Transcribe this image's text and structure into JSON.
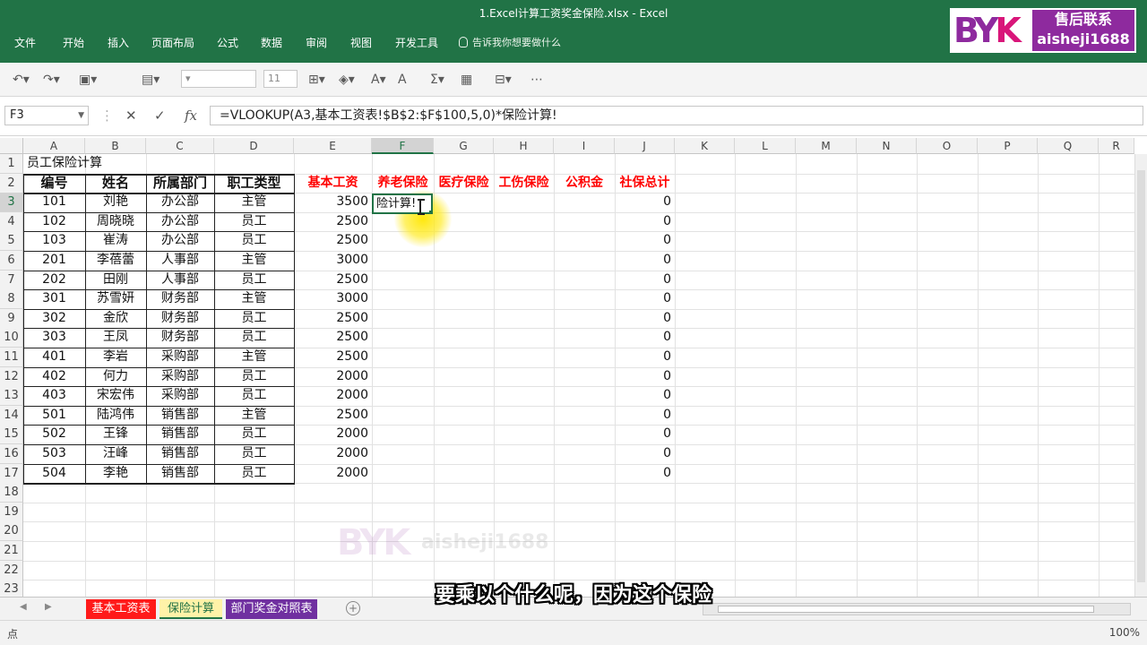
{
  "window": {
    "title": "1.Excel计算工资奖金保险.xlsx - Excel"
  },
  "menu": [
    "文件",
    "开始",
    "插入",
    "页面布局",
    "公式",
    "数据",
    "审阅",
    "视图",
    "开发工具"
  ],
  "tell_me": "告诉我你想要做什么",
  "logo": {
    "line1": "售后联系",
    "line2": "aisheji1688"
  },
  "toolbar": {
    "font_size": "11"
  },
  "formula_bar": {
    "name_box": "F3",
    "formula": "=VLOOKUP(A3,基本工资表!$B$2:$F$100,5,0)*保险计算!"
  },
  "columns": [
    "A",
    "B",
    "C",
    "D",
    "E",
    "F",
    "G",
    "H",
    "I",
    "J",
    "K",
    "L",
    "M",
    "N",
    "O",
    "P",
    "Q",
    "R"
  ],
  "rows": [
    "1",
    "2",
    "3",
    "4",
    "5",
    "6",
    "7",
    "8",
    "9",
    "10",
    "11",
    "12",
    "13",
    "14",
    "15",
    "16",
    "17",
    "18",
    "19",
    "20",
    "21",
    "22",
    "23"
  ],
  "sheet": {
    "title": "员工保险计算",
    "headers_left": [
      "编号",
      "姓名",
      "所属部门",
      "职工类型"
    ],
    "headers_right": [
      "基本工资",
      "养老保险",
      "医疗保险",
      "工伤保险",
      "公积金",
      "社保总计"
    ],
    "active_cell_text": "险计算!",
    "rows": [
      {
        "id": "101",
        "name": "刘艳",
        "dept": "办公部",
        "type": "主管",
        "salary": "3500",
        "total": "0"
      },
      {
        "id": "102",
        "name": "周晓晓",
        "dept": "办公部",
        "type": "员工",
        "salary": "2500",
        "total": "0"
      },
      {
        "id": "103",
        "name": "崔涛",
        "dept": "办公部",
        "type": "员工",
        "salary": "2500",
        "total": "0"
      },
      {
        "id": "201",
        "name": "李蓓蕾",
        "dept": "人事部",
        "type": "主管",
        "salary": "3000",
        "total": "0"
      },
      {
        "id": "202",
        "name": "田刚",
        "dept": "人事部",
        "type": "员工",
        "salary": "2500",
        "total": "0"
      },
      {
        "id": "301",
        "name": "苏雪妍",
        "dept": "财务部",
        "type": "主管",
        "salary": "3000",
        "total": "0"
      },
      {
        "id": "302",
        "name": "金欣",
        "dept": "财务部",
        "type": "员工",
        "salary": "2500",
        "total": "0"
      },
      {
        "id": "303",
        "name": "王凤",
        "dept": "财务部",
        "type": "员工",
        "salary": "2500",
        "total": "0"
      },
      {
        "id": "401",
        "name": "李岩",
        "dept": "采购部",
        "type": "主管",
        "salary": "2500",
        "total": "0"
      },
      {
        "id": "402",
        "name": "何力",
        "dept": "采购部",
        "type": "员工",
        "salary": "2000",
        "total": "0"
      },
      {
        "id": "403",
        "name": "宋宏伟",
        "dept": "采购部",
        "type": "员工",
        "salary": "2000",
        "total": "0"
      },
      {
        "id": "501",
        "name": "陆鸿伟",
        "dept": "销售部",
        "type": "主管",
        "salary": "2500",
        "total": "0"
      },
      {
        "id": "502",
        "name": "王锋",
        "dept": "销售部",
        "type": "员工",
        "salary": "2000",
        "total": "0"
      },
      {
        "id": "503",
        "name": "汪峰",
        "dept": "销售部",
        "type": "员工",
        "salary": "2000",
        "total": "0"
      },
      {
        "id": "504",
        "name": "李艳",
        "dept": "销售部",
        "type": "员工",
        "salary": "2000",
        "total": "0"
      }
    ]
  },
  "watermark": "aisheji1688",
  "tabs": [
    {
      "label": "基本工资表",
      "color": "#ff1a1a"
    },
    {
      "label": "保险计算",
      "color": "#fff2a8"
    },
    {
      "label": "部门奖金对照表",
      "color": "#7030a0"
    }
  ],
  "status": {
    "mode": "点",
    "zoom": "100%"
  },
  "subtitle": "要乘以个什么呢，因为这个保险"
}
